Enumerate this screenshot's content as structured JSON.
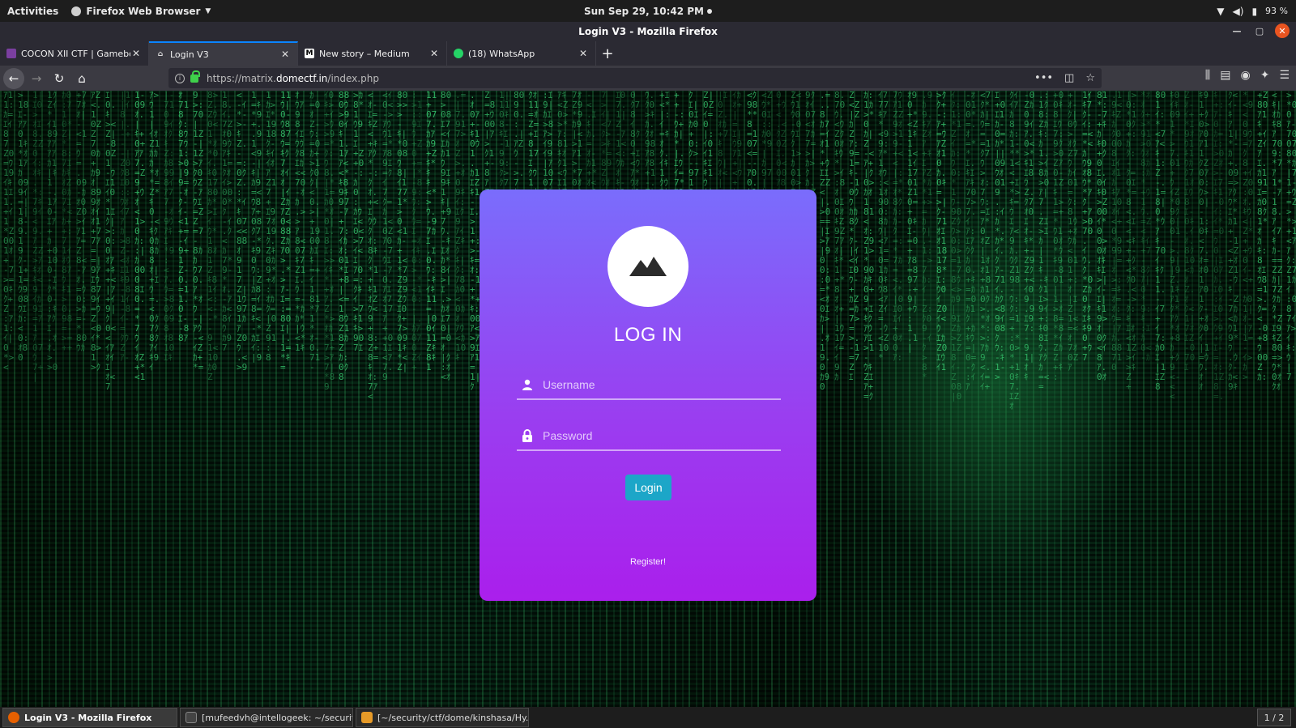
{
  "system_bar": {
    "activities": "Activities",
    "app_menu": "Firefox Web Browser",
    "clock": "Sun Sep 29, 10:42 PM",
    "battery": "93 %"
  },
  "window": {
    "title": "Login V3 - Mozilla Firefox"
  },
  "tabs": [
    {
      "label": "COCON XII CTF | Gameboard",
      "icon": "ctf-favicon",
      "active": false
    },
    {
      "label": "Login V3",
      "icon": "home-favicon",
      "active": true
    },
    {
      "label": "New story – Medium",
      "icon": "medium-favicon",
      "active": false
    },
    {
      "label": "(18) WhatsApp",
      "icon": "whatsapp-favicon",
      "active": false
    }
  ],
  "urlbar": {
    "prefix": "https://matrix.",
    "domain": "domectf.in",
    "path": "/index.php"
  },
  "login": {
    "title": "LOG IN",
    "username_placeholder": "Username",
    "password_placeholder": "Password",
    "button": "Login",
    "register_link": "Register!"
  },
  "colors": {
    "card_top": "#7a6dfc",
    "card_bottom": "#aa1fec",
    "button": "#1ca6c8",
    "matrix_green": "#3ee07c"
  },
  "taskbar": {
    "items": [
      {
        "label": "Login V3 - Mozilla Firefox",
        "active": true
      },
      {
        "label": "[mufeedvh@intellogeek: ~/securit...",
        "active": false
      },
      {
        "label": "[~/security/ctf/dome/kinshasa/Hy...",
        "active": false
      }
    ],
    "workspace": "1 / 2"
  }
}
